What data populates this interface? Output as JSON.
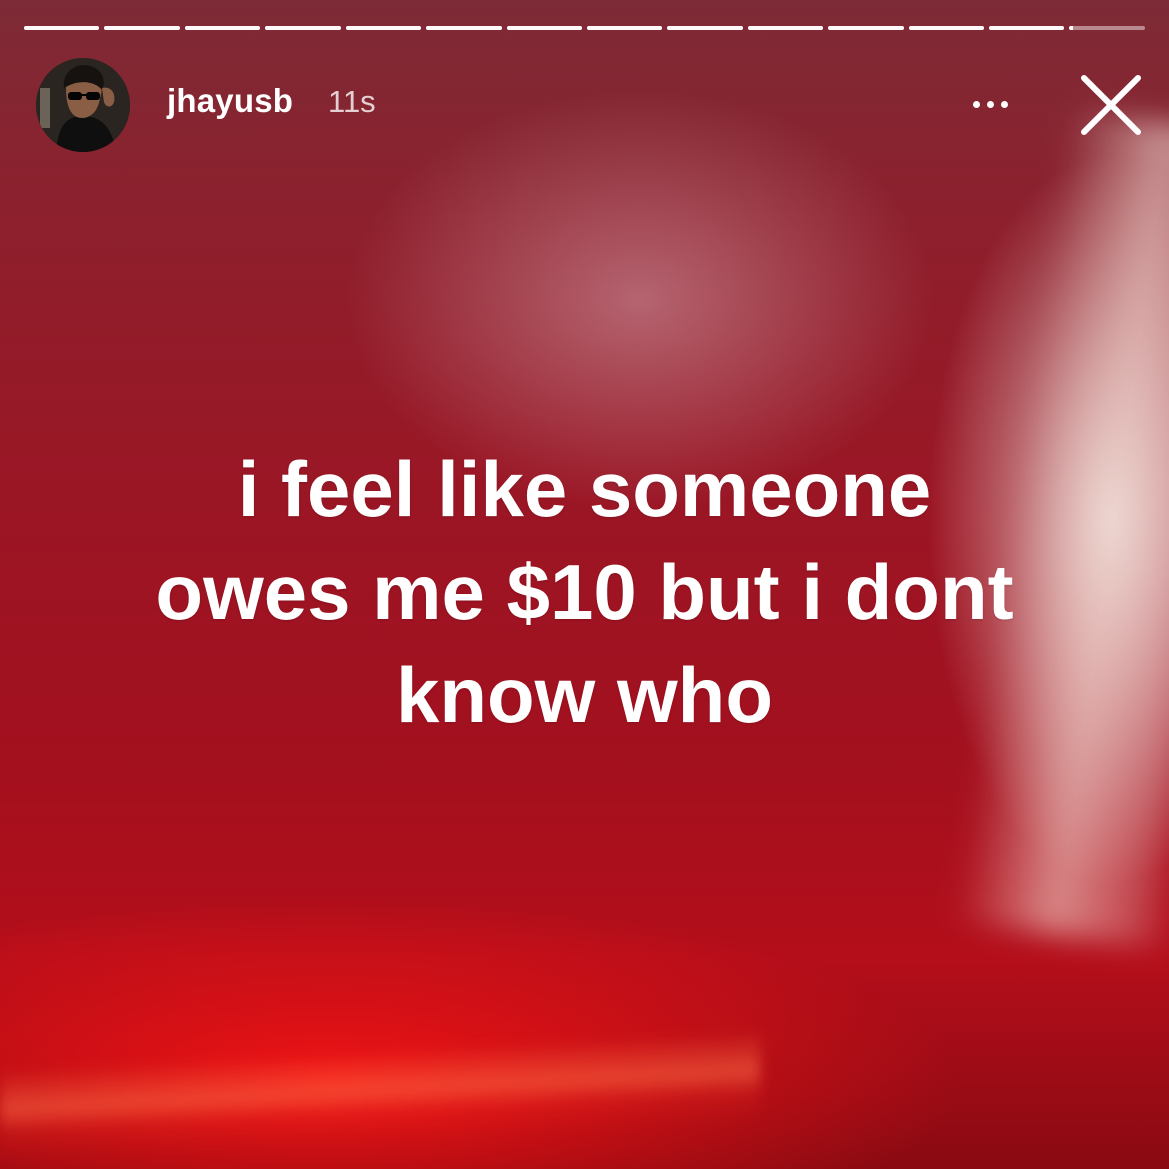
{
  "story": {
    "segments_total": 14,
    "segments_completed": 13,
    "current_segment_progress": 0.05,
    "user": {
      "username": "jhayusb",
      "posted_ago": "11s"
    },
    "more_icon": "more-horizontal-icon",
    "close_icon": "close-icon",
    "caption_lines": [
      "i feel like someone",
      "owes me $10 but i dont",
      "know who"
    ],
    "text_color": "#ffffff",
    "background_color": "#a3101e"
  }
}
